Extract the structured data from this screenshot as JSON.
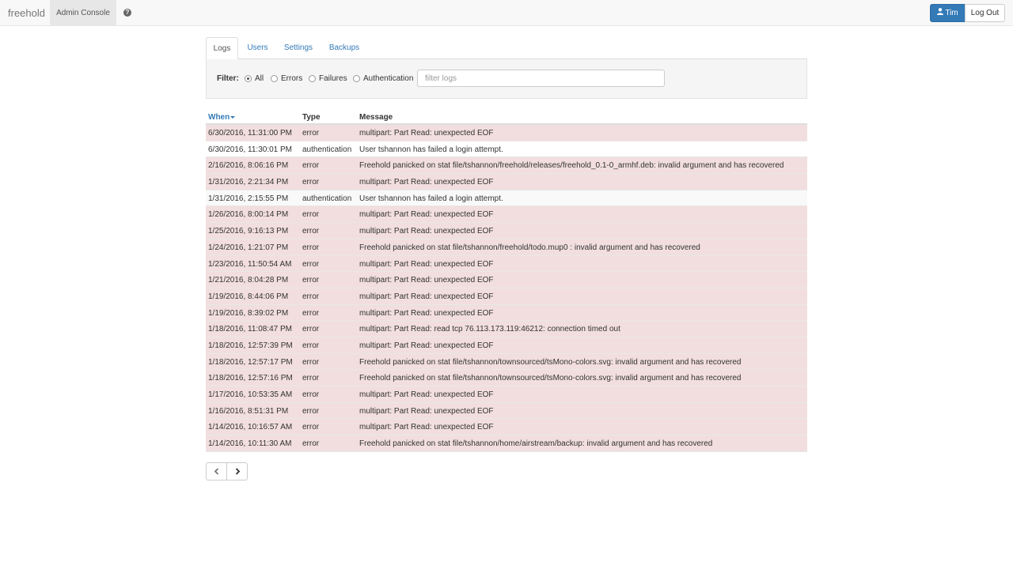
{
  "navbar": {
    "brand": "freehold",
    "admin_label": "Admin Console",
    "help_icon": "question-circle-icon",
    "user_label": "Tim",
    "user_icon": "user-icon",
    "logout_label": "Log Out"
  },
  "tabs": [
    "Logs",
    "Users",
    "Settings",
    "Backups"
  ],
  "filter": {
    "label": "Filter:",
    "options": [
      "All",
      "Errors",
      "Failures",
      "Authentication"
    ],
    "selected": "All",
    "placeholder": "filter logs"
  },
  "table": {
    "headers": {
      "when": "When",
      "type": "Type",
      "message": "Message"
    },
    "rows": [
      {
        "when": "6/30/2016, 11:31:00 PM",
        "type": "error",
        "message": "multipart: Part Read: unexpected EOF"
      },
      {
        "when": "6/30/2016, 11:30:01 PM",
        "type": "authentication",
        "message": "User tshannon has failed a login attempt."
      },
      {
        "when": "2/16/2016, 8:06:16 PM",
        "type": "error",
        "message": "Freehold panicked on stat file/tshannon/freehold/releases/freehold_0.1-0_armhf.deb: invalid argument and has recovered"
      },
      {
        "when": "1/31/2016, 2:21:34 PM",
        "type": "error",
        "message": "multipart: Part Read: unexpected EOF"
      },
      {
        "when": "1/31/2016, 2:15:55 PM",
        "type": "authentication",
        "message": "User tshannon has failed a login attempt."
      },
      {
        "when": "1/26/2016, 8:00:14 PM",
        "type": "error",
        "message": "multipart: Part Read: unexpected EOF"
      },
      {
        "when": "1/25/2016, 9:16:13 PM",
        "type": "error",
        "message": "multipart: Part Read: unexpected EOF"
      },
      {
        "when": "1/24/2016, 1:21:07 PM",
        "type": "error",
        "message": "Freehold panicked on stat file/tshannon/freehold/todo.mup0 : invalid argument and has recovered"
      },
      {
        "when": "1/23/2016, 11:50:54 AM",
        "type": "error",
        "message": "multipart: Part Read: unexpected EOF"
      },
      {
        "when": "1/21/2016, 8:04:28 PM",
        "type": "error",
        "message": "multipart: Part Read: unexpected EOF"
      },
      {
        "when": "1/19/2016, 8:44:06 PM",
        "type": "error",
        "message": "multipart: Part Read: unexpected EOF"
      },
      {
        "when": "1/19/2016, 8:39:02 PM",
        "type": "error",
        "message": "multipart: Part Read: unexpected EOF"
      },
      {
        "when": "1/18/2016, 11:08:47 PM",
        "type": "error",
        "message": "multipart: Part Read: read tcp 76.113.173.119:46212: connection timed out"
      },
      {
        "when": "1/18/2016, 12:57:39 PM",
        "type": "error",
        "message": "multipart: Part Read: unexpected EOF"
      },
      {
        "when": "1/18/2016, 12:57:17 PM",
        "type": "error",
        "message": "Freehold panicked on stat file/tshannon/townsourced/tsMono-colors.svg: invalid argument and has recovered"
      },
      {
        "when": "1/18/2016, 12:57:16 PM",
        "type": "error",
        "message": "Freehold panicked on stat file/tshannon/townsourced/tsMono-colors.svg: invalid argument and has recovered"
      },
      {
        "when": "1/17/2016, 10:53:35 AM",
        "type": "error",
        "message": "multipart: Part Read: unexpected EOF"
      },
      {
        "when": "1/16/2016, 8:51:31 PM",
        "type": "error",
        "message": "multipart: Part Read: unexpected EOF"
      },
      {
        "when": "1/14/2016, 10:16:57 AM",
        "type": "error",
        "message": "multipart: Part Read: unexpected EOF"
      },
      {
        "when": "1/14/2016, 10:11:30 AM",
        "type": "error",
        "message": "Freehold panicked on stat file/tshannon/home/airstream/backup: invalid argument and has recovered"
      }
    ]
  },
  "pager": {
    "prev_icon": "chevron-left-icon",
    "next_icon": "chevron-right-icon"
  },
  "colors": {
    "accent": "#337ab7",
    "error_row": "#f2dede"
  }
}
